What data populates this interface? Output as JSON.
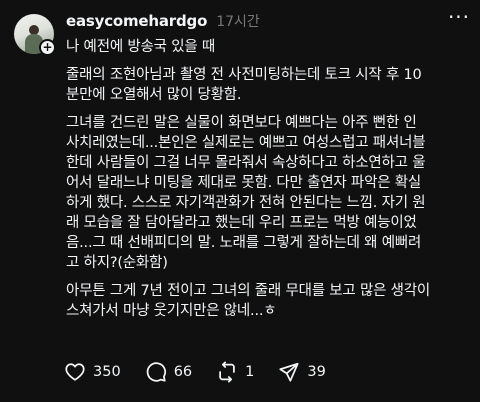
{
  "post": {
    "username": "easycomehardgo",
    "time": "17시간",
    "follow_symbol": "+",
    "more_symbol": "···",
    "paragraphs": [
      "나 예전에 방송국 있을 때",
      "줄래의 조현아님과 촬영 전 사전미팅하는데 토크 시작 후 10\n분만에 오열해서 많이 당황함.",
      "그녀를 건드린 말은 실물이 화면보다 예쁘다는 아주 뻔한 인\n사치레였는데...본인은 실제로는 예쁘고 여성스럽고 패셔너블\n한데 사람들이 그걸 너무 몰라줘서 속상하다고 하소연하고 울\n어서 달래느냐 미팅을 제대로 못함. 다만 출연자 파악은 확실\n하게 했다. 스스로 자기객관화가 전혀 안된다는 느낌. 자기 원\n래 모습을 잘 담아달라고 했는데 우리 프로는 먹방 예능이었\n음...그 때 선배피디의 말. 노래를 그렇게 잘하는데 왜 예뻐려\n고 하지?(순화함)",
      "아무튼 그게 7년 전이고 그녀의 줄래 무대를 보고 많은 생각이\n스쳐가서 마냥 웃기지만은 않네...ㅎ"
    ]
  },
  "actions": {
    "likes": "350",
    "replies": "66",
    "reposts": "1",
    "shares": "39"
  },
  "icons": {
    "like": "heart-icon",
    "reply": "comment-bubble-icon",
    "repost": "repost-arrows-icon",
    "share": "send-icon"
  },
  "colors": {
    "background": "#101010",
    "text": "#f3f5f7",
    "secondary": "#777777"
  }
}
